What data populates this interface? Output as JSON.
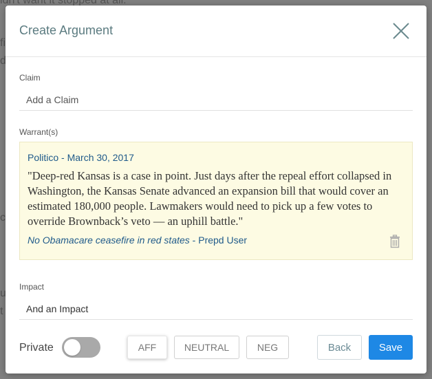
{
  "background": {
    "lines": [
      {
        "text": "idn't want it stopped at all."
      },
      {
        "text": "fi"
      },
      {
        "text": "d"
      },
      {
        "text": "c"
      },
      {
        "text": "u"
      },
      {
        "text": "t"
      }
    ]
  },
  "modal": {
    "title": "Create Argument",
    "close_icon": "close-icon"
  },
  "claim": {
    "label": "Claim",
    "placeholder": "Add a Claim",
    "value": ""
  },
  "warrants": {
    "label": "Warrant(s)",
    "items": [
      {
        "source": "Politico",
        "separator": " - ",
        "date": "March 30, 2017",
        "quote": "\"Deep-red Kansas is a case in point. Just days after the repeal effort collapsed in Washington, the Kansas Senate advanced an expansion bill that would cover an estimated 180,000 people. Lawmakers would need to pick up a few votes to override Brownback’s veto — an uphill battle.\"",
        "article_title": "No Obamacare ceasefire in red states",
        "article_separator": " - ",
        "user": "Prepd User",
        "delete_icon": "trash-icon"
      }
    ]
  },
  "impact": {
    "label": "Impact",
    "placeholder": "And an Impact",
    "value": "And an Impact"
  },
  "footer": {
    "private_label": "Private",
    "private_on": false,
    "stances": [
      {
        "label": "AFF",
        "active": true
      },
      {
        "label": "NEUTRAL",
        "active": false
      },
      {
        "label": "NEG",
        "active": false
      }
    ],
    "back_label": "Back",
    "save_label": "Save"
  },
  "colors": {
    "primary": "#1e88e5",
    "title": "#5b7b80",
    "link": "#1f5a8a",
    "warrant_bg": "#fdfbe3"
  }
}
